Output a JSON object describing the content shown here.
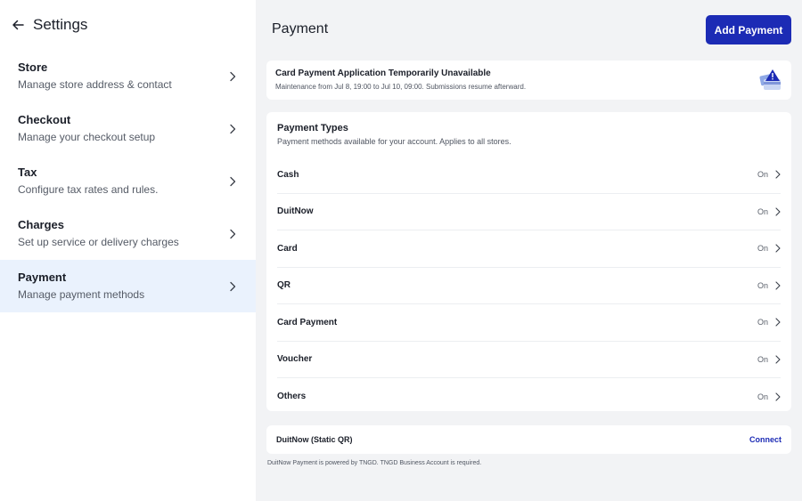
{
  "sidebar": {
    "title": "Settings",
    "items": [
      {
        "title": "Store",
        "desc": "Manage store address & contact"
      },
      {
        "title": "Checkout",
        "desc": "Manage your checkout setup"
      },
      {
        "title": "Tax",
        "desc": "Configure tax rates and rules."
      },
      {
        "title": "Charges",
        "desc": "Set up service or delivery charges"
      },
      {
        "title": "Payment",
        "desc": "Manage payment methods"
      }
    ],
    "active_index": 4
  },
  "main": {
    "title": "Payment",
    "add_button_label": "Add Payment",
    "notice": {
      "title": "Card Payment Application Temporarily Unavailable",
      "text": "Maintenance from Jul 8, 19:00 to Jul 10, 09:00. Submissions resume afterward."
    },
    "payment_types": {
      "title": "Payment Types",
      "desc": "Payment methods available for your account. Applies to all stores.",
      "rows": [
        {
          "label": "Cash",
          "status": "On"
        },
        {
          "label": "DuitNow",
          "status": "On"
        },
        {
          "label": "Card",
          "status": "On"
        },
        {
          "label": "QR",
          "status": "On"
        },
        {
          "label": "Card Payment",
          "status": "On"
        },
        {
          "label": "Voucher",
          "status": "On"
        },
        {
          "label": "Others",
          "status": "On"
        }
      ]
    },
    "duitnow_static": {
      "label": "DuitNow (Static QR)",
      "action": "Connect",
      "footnote": "DuitNow Payment is powered by TNGD. TNGD Business Account is required."
    }
  },
  "colors": {
    "accent": "#1c2bb5",
    "active_bg": "#eaf2fd",
    "main_bg": "#f2f3f5"
  }
}
